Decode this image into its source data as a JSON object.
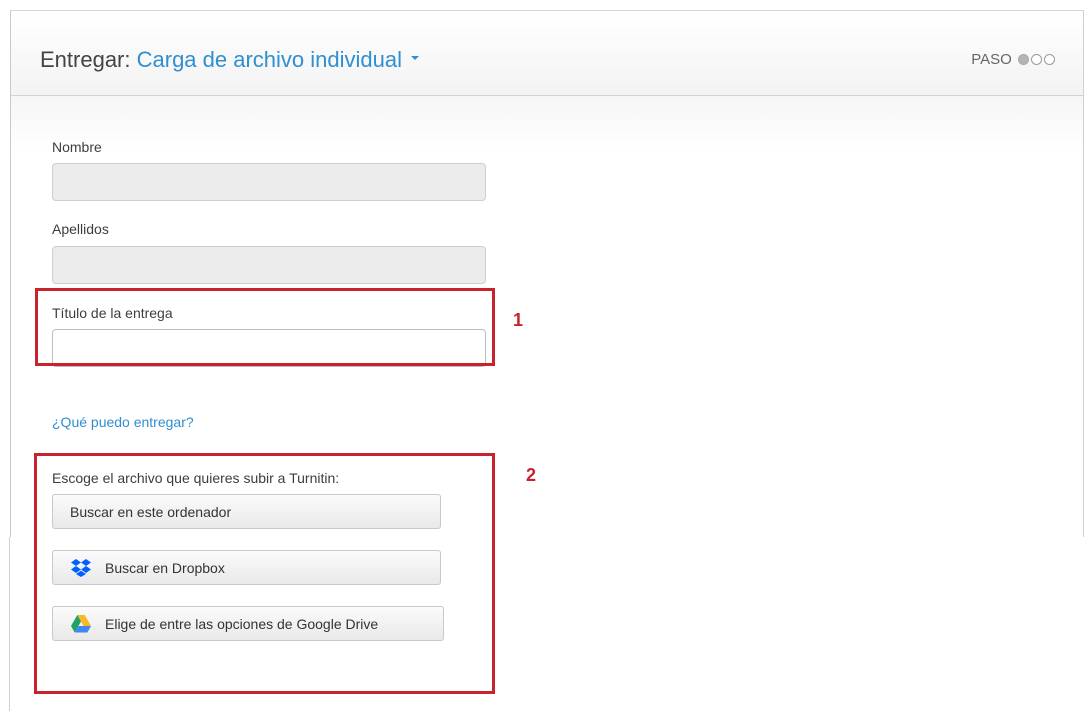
{
  "panel": {
    "title_prefix": "Entregar:",
    "title_dropdown": "Carga de archivo individual",
    "step_label": "PASO",
    "step_current": 1,
    "step_total": 3
  },
  "form": {
    "first_name_label": "Nombre",
    "first_name_value": "",
    "last_name_label": "Apellidos",
    "last_name_value": "",
    "title_label": "Título de la entrega",
    "title_value": "",
    "help_link": "¿Qué puedo entregar?",
    "choose_file_label": "Escoge el archivo que quieres subir a Turnitin:",
    "buttons": {
      "computer": "Buscar en este ordenador",
      "dropbox": "Buscar en Dropbox",
      "google_drive": "Elige de entre las opciones de Google Drive"
    }
  },
  "annotations": {
    "box1_number": "1",
    "box2_number": "2",
    "color": "#c8222c"
  },
  "colors": {
    "accent_link": "#2f8fd0",
    "dropbox_blue": "#0061fe"
  },
  "icons": {
    "dropdown": "caret-down-icon",
    "dropbox": "dropbox-icon",
    "google_drive": "google-drive-icon",
    "step_dots": "step-indicator-dots"
  }
}
